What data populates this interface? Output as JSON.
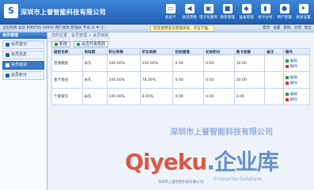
{
  "app": {
    "logo_letter": "S",
    "company": "深圳市上誉智能科技有限公司"
  },
  "nav": [
    {
      "label": "会员卡",
      "icon": "card-icon"
    },
    {
      "label": "会员营销",
      "icon": "megaphone-icon"
    },
    {
      "label": "电子化服务",
      "icon": "monitor-icon"
    },
    {
      "label": "库存管理",
      "icon": "box-icon"
    },
    {
      "label": "设备管理",
      "icon": "device-icon"
    },
    {
      "label": "统计分析",
      "icon": "chart-icon"
    },
    {
      "label": "用户管理",
      "icon": "users-icon"
    },
    {
      "label": "系统设置",
      "icon": "gear-icon"
    }
  ],
  "infobar": {
    "user_info": "当前机构:总店   机构代码:10000   用户角色:管理员   字号 大 中 小",
    "notice": "欢迎使用会员管理系统，点击下载...",
    "actions": [
      "首页",
      "设置",
      "帮助",
      "文档",
      "退出"
    ]
  },
  "sidebar": {
    "heading": "会员管理",
    "items": [
      {
        "label": "会员登记",
        "active": false
      },
      {
        "label": "会员信息",
        "active": false
      },
      {
        "label": "会员级别",
        "active": true
      },
      {
        "label": "会员积分",
        "active": false
      }
    ]
  },
  "main": {
    "breadcrumb": "您的位置：会员管理 > 会员级别",
    "toolbar": {
      "new_label": "新增",
      "upgrade_label": "会员升级规则"
    },
    "table": {
      "headers": [
        "级别名称",
        "有效期",
        "积分系数",
        "折扣系数",
        "初始储值",
        "初始积分",
        "售卡金额",
        "备注",
        "操作"
      ],
      "rows": [
        [
          "普通级别",
          "永久",
          "100.00%",
          "100.00%",
          "0.00",
          "0.00",
          "10.00",
          ""
        ],
        [
          "金卡会员",
          "永久",
          "100.00%",
          "78.00%",
          "0.00",
          "0.00",
          "20.00",
          ""
        ],
        [
          "个家管方",
          "永久",
          "100.00%",
          "6.00%",
          "0.00",
          "0.00",
          "0.00",
          ""
        ]
      ],
      "edit_label": "编辑",
      "delete_label": "删除"
    }
  },
  "watermarks": {
    "top": "圳市上誉智能科技有限公司",
    "company": "深圳市上誉智能科技有限公司",
    "logo_main": "Qiyeku",
    "logo_cn": ".企业库",
    "sub": "Enterprise Database"
  },
  "footer": "深圳市上誉智能科技有限公司"
}
